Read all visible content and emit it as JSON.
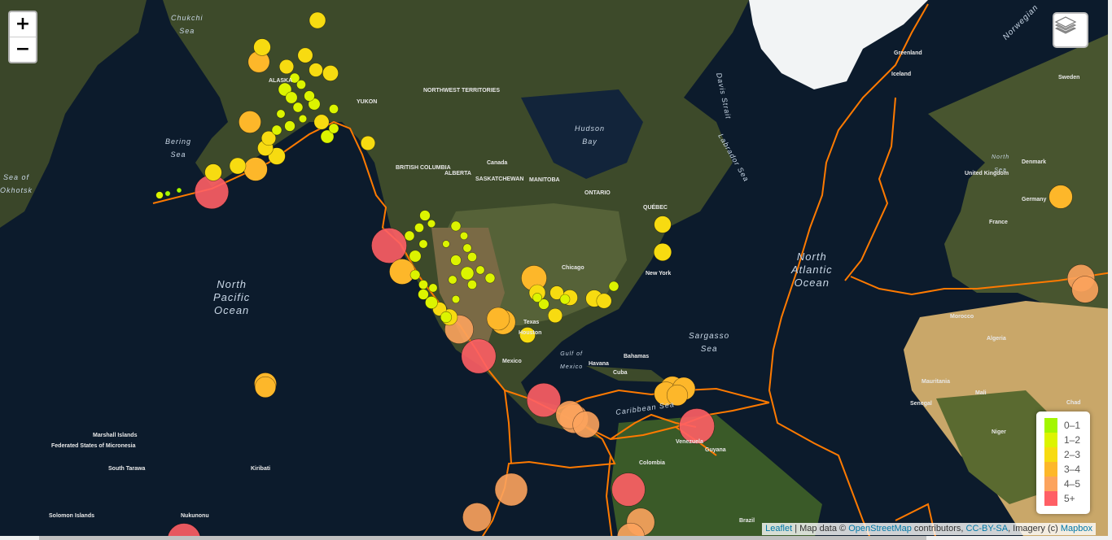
{
  "map": {
    "zoom_in_label": "+",
    "zoom_out_label": "−",
    "layers_icon": "layers-icon"
  },
  "labels": {
    "ocean": [
      {
        "id": "north-pacific",
        "text": "North\nPacific\nOcean"
      },
      {
        "id": "north-atlantic",
        "text": "North\nAtlantic\nOcean"
      },
      {
        "id": "sargasso",
        "text": "Sargasso\nSea"
      },
      {
        "id": "bering",
        "text": "Bering\nSea"
      },
      {
        "id": "okhotsk",
        "text": "Sea of\nOkhotsk"
      },
      {
        "id": "chukchi",
        "text": "Chukchi\nSea"
      },
      {
        "id": "hudson",
        "text": "Hudson\nBay"
      },
      {
        "id": "davis",
        "text": "Davis Strait"
      },
      {
        "id": "labrador",
        "text": "Labrador Sea"
      },
      {
        "id": "caribbean",
        "text": "Caribbean Sea"
      },
      {
        "id": "gulf-mexico",
        "text": "Gulf of\nMexico"
      },
      {
        "id": "north-sea",
        "text": "North\nSea"
      },
      {
        "id": "norwegian",
        "text": "Norwegian"
      }
    ],
    "places": [
      "Canada",
      "ALASKA",
      "YUKON",
      "NORTHWEST TERRITORIES",
      "BRITISH COLUMBIA",
      "ALBERTA",
      "SASKATCHEWAN",
      "MANITOBA",
      "ONTARIO",
      "QUÉBEC",
      "Greenland",
      "Iceland",
      "United Kingdom",
      "France",
      "Germany",
      "Denmark",
      "Sweden",
      "Algeria",
      "Mali",
      "Niger",
      "Chad",
      "Mauritania",
      "Senegal",
      "Morocco",
      "Mexico",
      "Cuba",
      "Venezuela",
      "Colombia",
      "Brazil",
      "Guyana",
      "Bahamas",
      "Havana",
      "New York",
      "Chicago",
      "Houston",
      "Texas",
      "Kiribati",
      "Marshall Islands",
      "Federated States of Micronesia",
      "South Tarawa",
      "Solomon Islands",
      "Nukunonu"
    ]
  },
  "legend": {
    "items": [
      {
        "label": "0–1",
        "color": "#a3f600"
      },
      {
        "label": "1–2",
        "color": "#dcf400"
      },
      {
        "label": "2–3",
        "color": "#f7db11"
      },
      {
        "label": "3–4",
        "color": "#fdb72a"
      },
      {
        "label": "4–5",
        "color": "#fca35d"
      },
      {
        "label": "5+",
        "color": "#ff5f65"
      }
    ]
  },
  "attribution": {
    "leaflet": "Leaflet",
    "sep": " | Map data © ",
    "osm": "OpenStreetMap",
    "contrib": " contributors, ",
    "license": "CC-BY-SA",
    "imagery": ", Imagery (c) ",
    "mapbox": "Mapbox"
  },
  "colors": {
    "plates": "#ff7a00",
    "mag0": "#a3f600",
    "mag1": "#dcf400",
    "mag2": "#f7db11",
    "mag3": "#fdb72a",
    "mag4": "#fca35d",
    "mag5": "#ff5f65"
  }
}
